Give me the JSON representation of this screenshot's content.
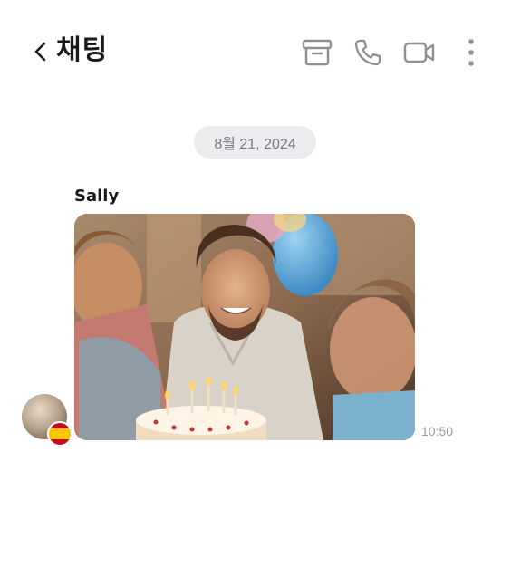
{
  "header": {
    "title": "채팅",
    "back_icon": "chevron-left-icon",
    "actions": [
      {
        "icon": "archive-icon"
      },
      {
        "icon": "phone-icon"
      },
      {
        "icon": "video-camera-icon"
      },
      {
        "icon": "more-vertical-icon"
      }
    ]
  },
  "date_divider": "8월 21, 2024",
  "message": {
    "sender": "Sally",
    "time": "10:50",
    "attachment_type": "image",
    "avatar_flag": "spain-flag"
  },
  "colors": {
    "icon_gray": "#8e8e93",
    "chip_bg": "#ececef",
    "chip_text": "#7b7b80",
    "time_text": "#9b9b9f"
  }
}
